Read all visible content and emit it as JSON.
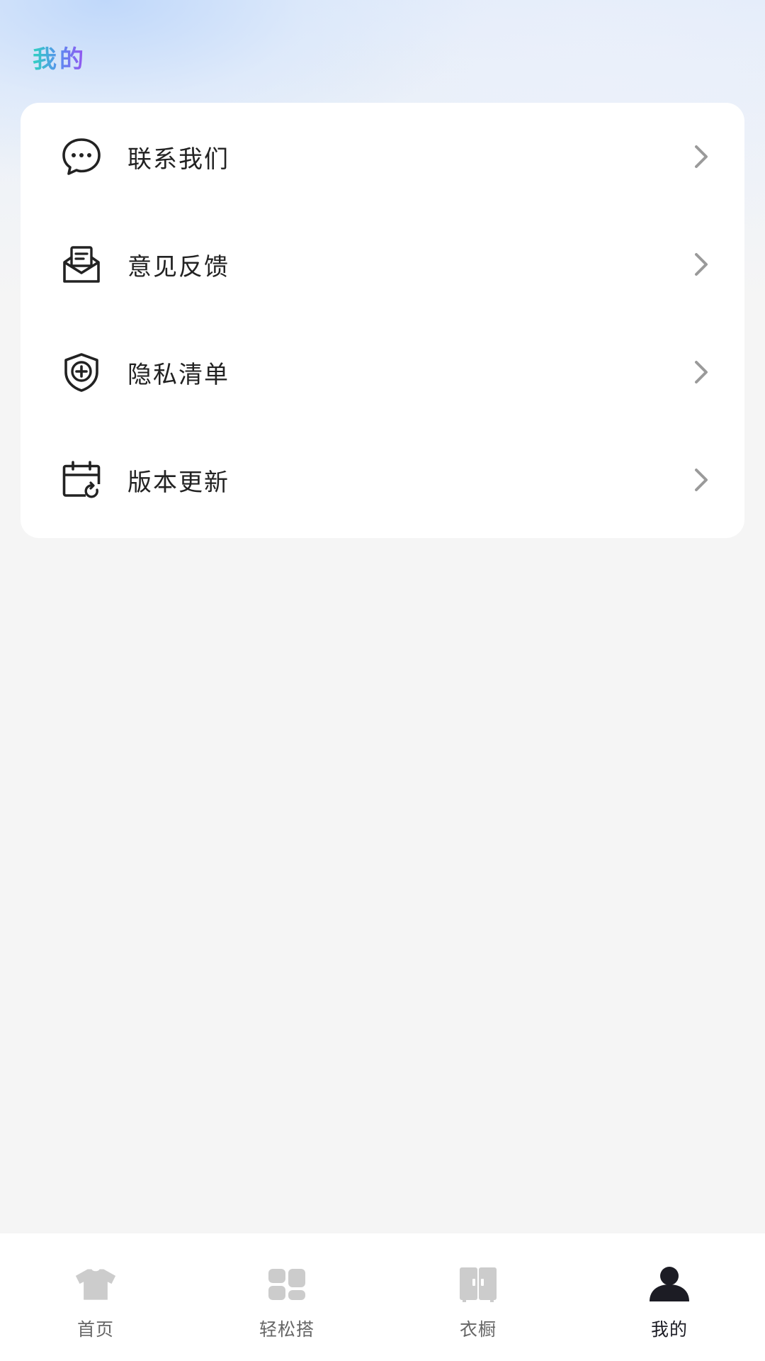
{
  "header": {
    "title": "我的"
  },
  "menu": {
    "items": [
      {
        "label": "联系我们",
        "icon": "chat-bubble-icon"
      },
      {
        "label": "意见反馈",
        "icon": "envelope-icon"
      },
      {
        "label": "隐私清单",
        "icon": "shield-plus-icon"
      },
      {
        "label": "版本更新",
        "icon": "calendar-refresh-icon"
      }
    ]
  },
  "tabbar": {
    "items": [
      {
        "label": "首页",
        "icon": "tshirt-icon",
        "active": false
      },
      {
        "label": "轻松搭",
        "icon": "grid-icon",
        "active": false
      },
      {
        "label": "衣橱",
        "icon": "wardrobe-icon",
        "active": false
      },
      {
        "label": "我的",
        "icon": "person-icon",
        "active": true
      }
    ]
  },
  "colors": {
    "page_background": "#f5f5f5",
    "card_background": "#ffffff",
    "text_primary": "#222222",
    "tab_inactive_icon": "#cccccc",
    "tab_active_icon": "#1c1c24",
    "title_gradient": [
      "#2fd3c0",
      "#5a8cf0",
      "#9b4ff0"
    ]
  }
}
